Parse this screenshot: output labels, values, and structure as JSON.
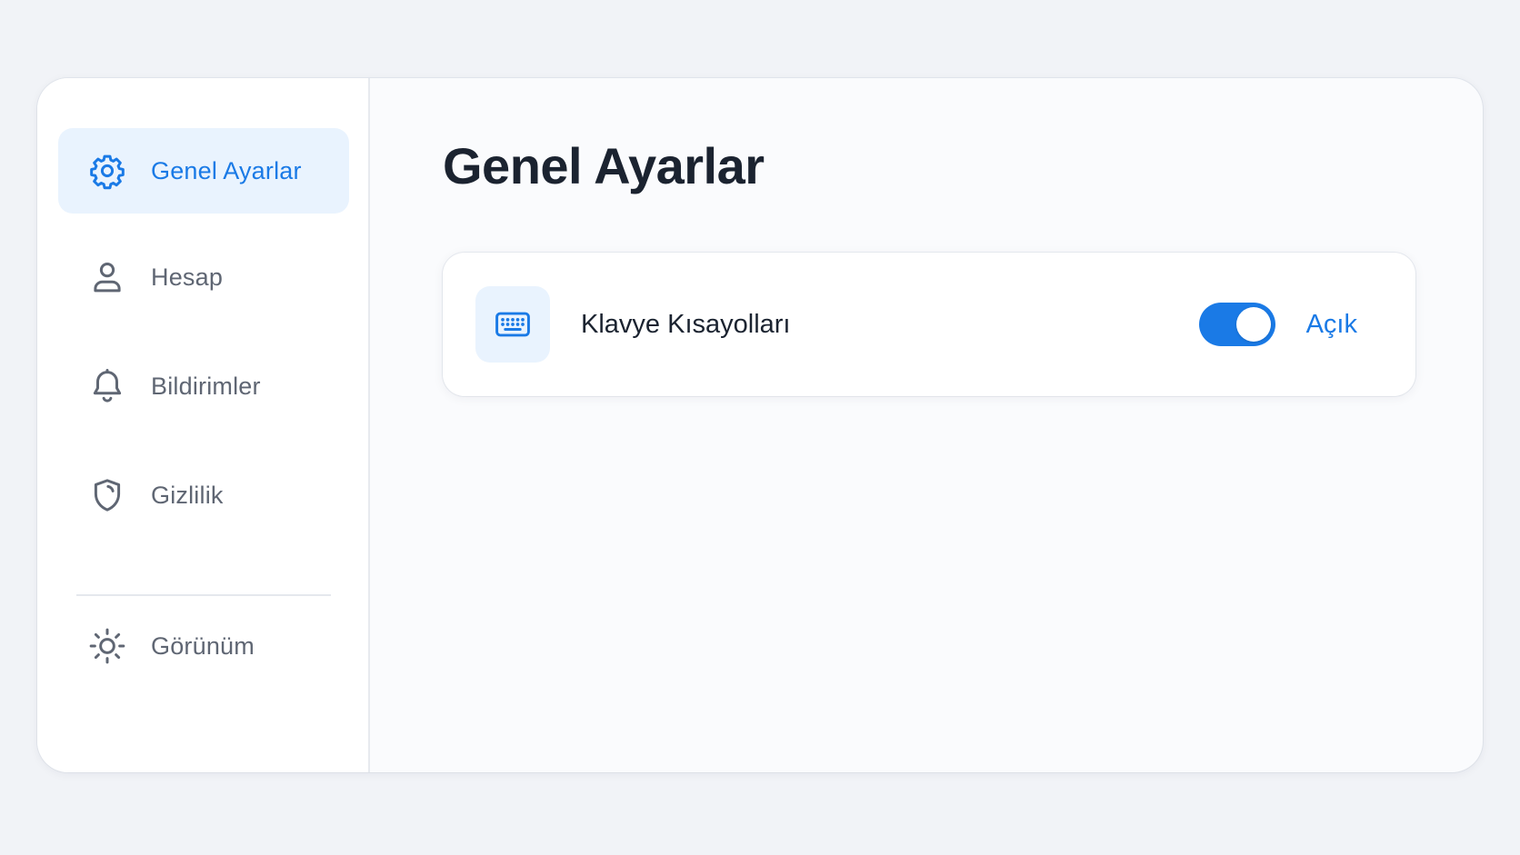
{
  "sidebar": {
    "items": [
      {
        "label": "Genel Ayarlar",
        "icon": "gear-icon",
        "active": true
      },
      {
        "label": "Hesap",
        "icon": "user-icon",
        "active": false
      },
      {
        "label": "Bildirimler",
        "icon": "bell-icon",
        "active": false
      },
      {
        "label": "Gizlilik",
        "icon": "shield-icon",
        "active": false
      },
      {
        "label": "Görünüm",
        "icon": "sun-icon",
        "active": false
      }
    ]
  },
  "main": {
    "title": "Genel Ayarlar",
    "setting": {
      "label": "Klavye Kısayolları",
      "icon": "keyboard-icon",
      "enabled": true,
      "status_label": "Açık"
    }
  },
  "colors": {
    "accent": "#1a7ae6",
    "active_bg": "#e9f3fe",
    "text_primary": "#1b2330",
    "text_secondary": "#5f6673",
    "background": "#f1f3f7"
  }
}
